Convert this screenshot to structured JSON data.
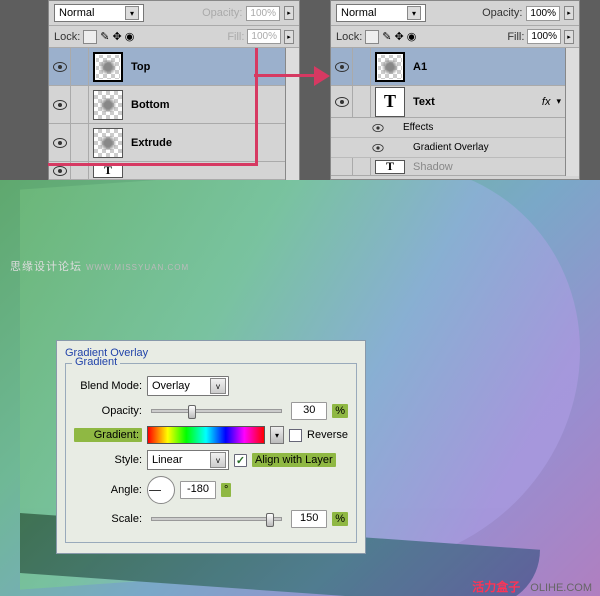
{
  "leftPanel": {
    "blendMode": "Normal",
    "opacityLabel": "Opacity:",
    "opacityValue": "100%",
    "lockLabel": "Lock:",
    "fillLabel": "Fill:",
    "fillValue": "100%",
    "layers": [
      {
        "name": "Top"
      },
      {
        "name": "Bottom"
      },
      {
        "name": "Extrude"
      },
      {
        "name": ""
      }
    ]
  },
  "rightPanel": {
    "blendMode": "Normal",
    "opacityLabel": "Opacity:",
    "opacityValue": "100%",
    "lockLabel": "Lock:",
    "fillLabel": "Fill:",
    "fillValue": "100%",
    "layers": {
      "a1": "A1",
      "text": "Text",
      "fx": "fx",
      "effects": "Effects",
      "gradOverlay": "Gradient Overlay",
      "shadow": "Shadow"
    }
  },
  "watermark1": {
    "main": "思缘设计论坛",
    "sub": "WWW.MISSYUAN.COM"
  },
  "watermark2": {
    "main": "活力盒子",
    "dom": "OLIHE.COM"
  },
  "dialog": {
    "title": "Gradient Overlay",
    "legend": "Gradient",
    "blendModeLabel": "Blend Mode:",
    "blendModeValue": "Overlay",
    "opacityLabel": "Opacity:",
    "opacityValue": "30",
    "pct": "%",
    "gradientLabel": "Gradient:",
    "reverseLabel": "Reverse",
    "styleLabel": "Style:",
    "styleValue": "Linear",
    "alignLabel": "Align with Layer",
    "angleLabel": "Angle:",
    "angleValue": "-180",
    "deg": "°",
    "scaleLabel": "Scale:",
    "scaleValue": "150"
  }
}
